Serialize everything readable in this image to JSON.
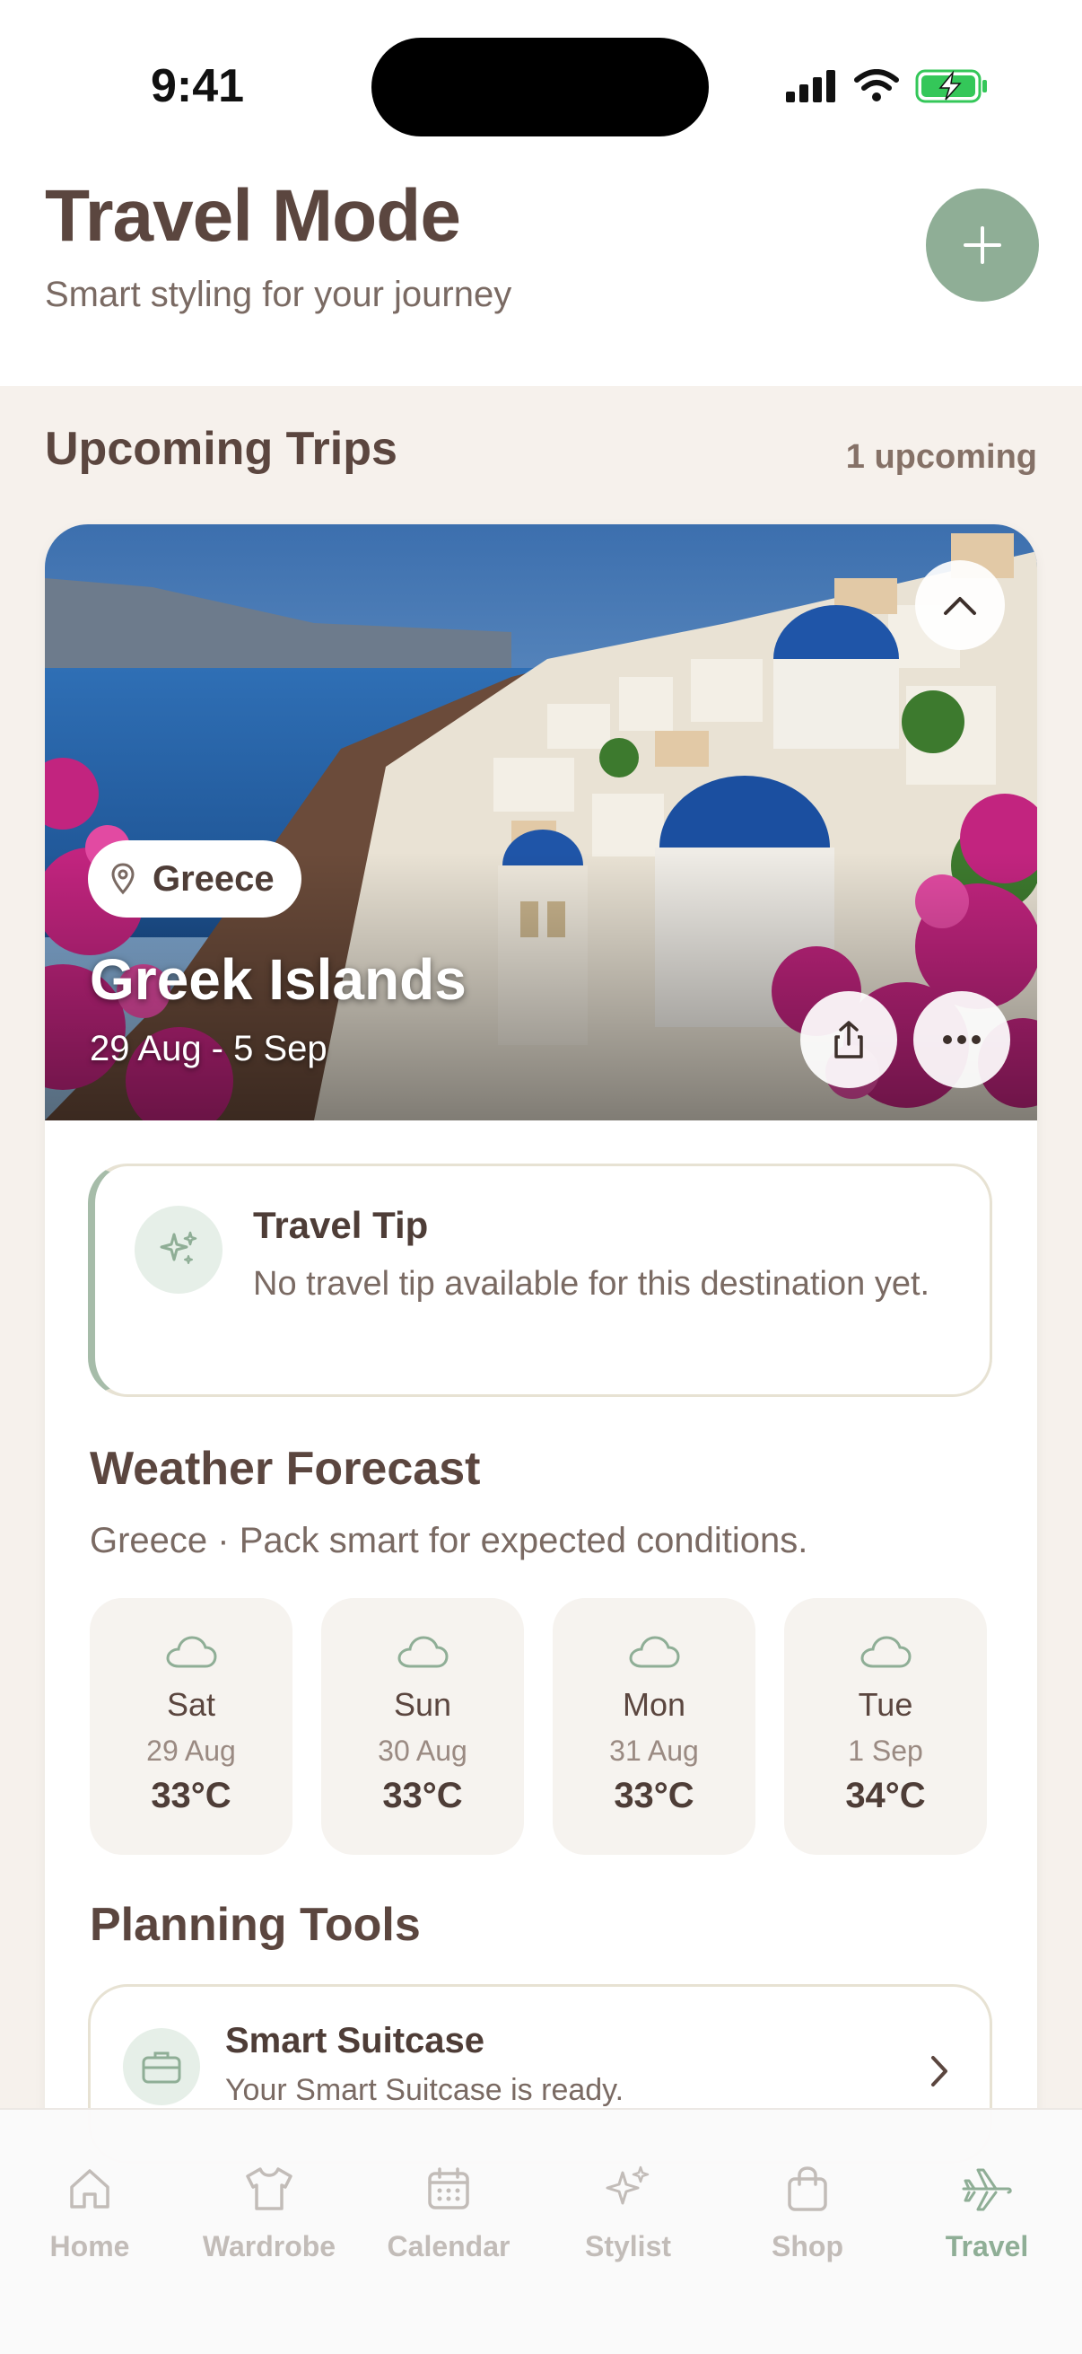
{
  "status_bar": {
    "time": "9:41"
  },
  "header": {
    "title": "Travel Mode",
    "subtitle": "Smart styling for your journey",
    "add_icon": "plus-icon"
  },
  "upcoming": {
    "title": "Upcoming Trips",
    "count": "1 upcoming"
  },
  "trip": {
    "location": "Greece",
    "name": "Greek Islands",
    "dates": "29 Aug - 5 Sep"
  },
  "tip": {
    "title": "Travel Tip",
    "text": "No travel tip available for this destination yet."
  },
  "weather": {
    "title": "Weather Forecast",
    "subtitle": "Greece · Pack smart for expected conditions.",
    "days": [
      {
        "day": "Sat",
        "date": "29 Aug",
        "temp": "33°C",
        "icon": "cloud-icon"
      },
      {
        "day": "Sun",
        "date": "30 Aug",
        "temp": "33°C",
        "icon": "cloud-icon"
      },
      {
        "day": "Mon",
        "date": "31 Aug",
        "temp": "33°C",
        "icon": "cloud-icon"
      },
      {
        "day": "Tue",
        "date": "1 Sep",
        "temp": "34°C",
        "icon": "cloud-icon"
      }
    ]
  },
  "planning": {
    "title": "Planning Tools",
    "tools": [
      {
        "title": "Smart Suitcase",
        "subtitle": "Your Smart Suitcase is ready.",
        "icon": "briefcase-icon"
      }
    ]
  },
  "tabs": [
    {
      "label": "Home",
      "icon": "home-icon"
    },
    {
      "label": "Wardrobe",
      "icon": "shirt-icon"
    },
    {
      "label": "Calendar",
      "icon": "calendar-icon"
    },
    {
      "label": "Stylist",
      "icon": "sparkles-icon"
    },
    {
      "label": "Shop",
      "icon": "shopping-bag-icon"
    },
    {
      "label": "Travel",
      "icon": "airplane-icon",
      "active": true
    }
  ],
  "colors": {
    "accent": "#8fae96",
    "text": "#5b463f",
    "background": "#f6f1ec"
  }
}
